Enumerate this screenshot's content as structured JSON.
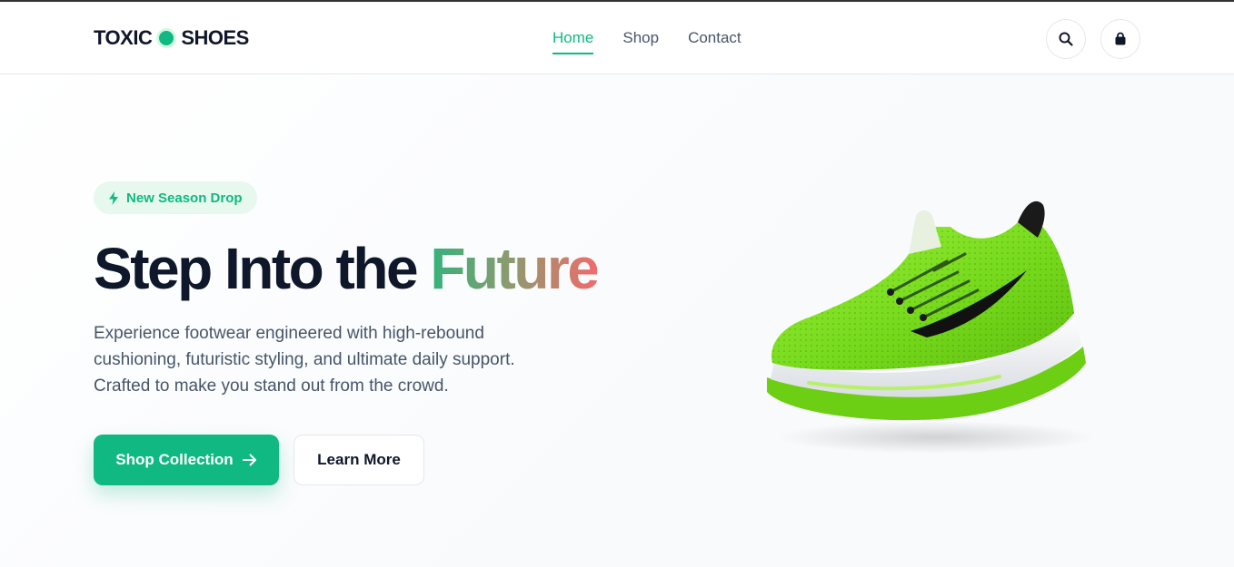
{
  "brand": {
    "left": "TOXIC",
    "right": "SHOES"
  },
  "nav": {
    "items": [
      {
        "label": "Home",
        "active": true
      },
      {
        "label": "Shop",
        "active": false
      },
      {
        "label": "Contact",
        "active": false
      }
    ]
  },
  "header_icons": [
    "search-icon",
    "shopping-bag-icon"
  ],
  "hero": {
    "badge": "New Season Drop",
    "title_main": "Step Into the",
    "title_accent": "Future",
    "description": "Experience footwear engineered with high-rebound cushioning, futuristic styling, and ultimate daily support. Crafted to make you stand out from the crowd.",
    "primary_button": "Shop Collection",
    "secondary_button": "Learn More"
  },
  "colors": {
    "accent": "#10b981",
    "text": "#0f172a",
    "muted": "#475569",
    "shoe": "#7ee01d"
  }
}
